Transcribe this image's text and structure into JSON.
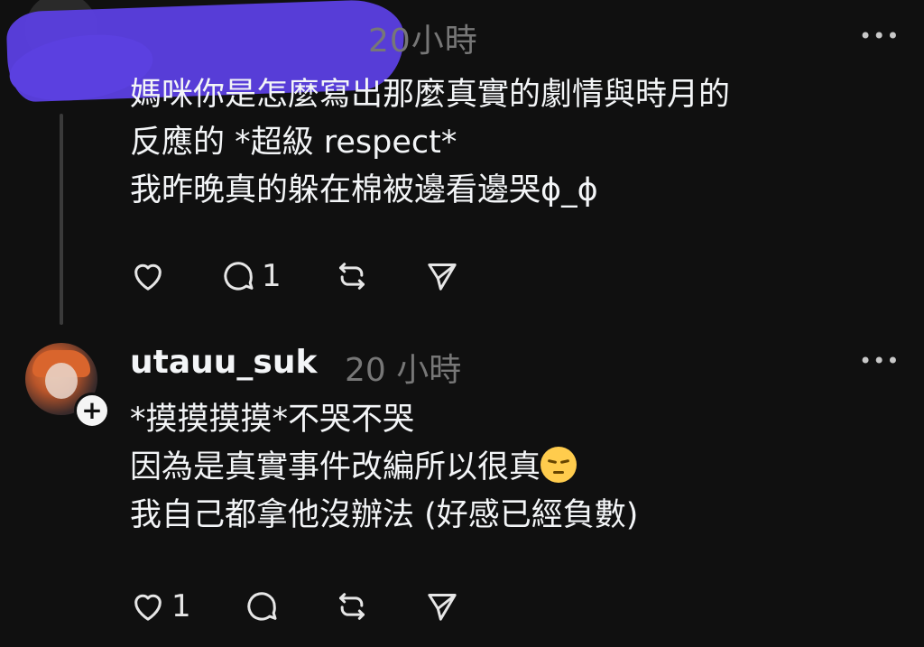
{
  "post1": {
    "time": "20小時",
    "lines": [
      "媽咪你是怎麼寫出那麼真實的劇情與時月的",
      "反應的 *超級 respect*",
      "我昨晚真的躲在棉被邊看邊哭ɸ_ɸ"
    ],
    "more_label": "•••",
    "actions": {
      "like_icon": "heart-icon",
      "reply_icon": "comment-icon",
      "reply_count": "1",
      "repost_icon": "repost-icon",
      "share_icon": "send-icon"
    }
  },
  "post2": {
    "username": "utauu_suk",
    "time": "20 小時",
    "follow_label": "+",
    "lines": [
      "*摸摸摸摸*不哭不哭",
      "因為是真實事件改編所以很真",
      "我自己都拿他沒辦法 (好感已經負數)"
    ],
    "emoji": "pensive-face-emoji",
    "more_label": "•••",
    "actions": {
      "like_icon": "heart-icon",
      "like_count": "1",
      "reply_icon": "comment-icon",
      "repost_icon": "repost-icon",
      "share_icon": "send-icon"
    }
  },
  "colors": {
    "background": "#101010",
    "text": "#f3f5f7",
    "muted": "#777777",
    "redaction": "#5b40e0"
  }
}
